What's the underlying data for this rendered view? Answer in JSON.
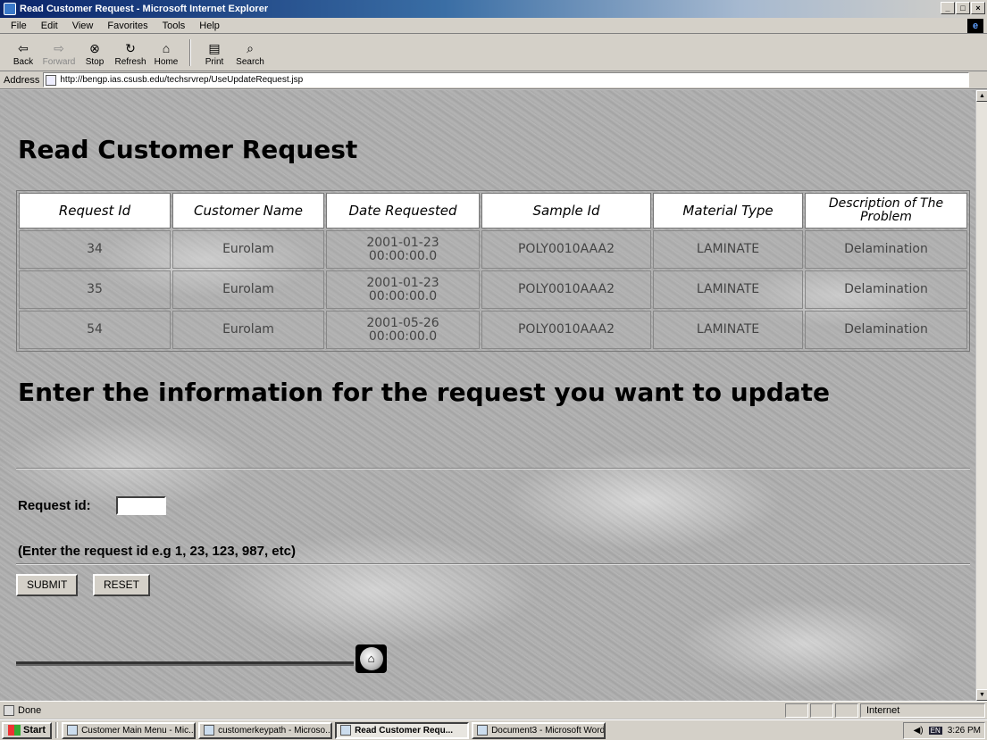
{
  "window": {
    "title": "Read Customer Request - Microsoft Internet Explorer"
  },
  "menu": [
    "File",
    "Edit",
    "View",
    "Favorites",
    "Tools",
    "Help"
  ],
  "toolbar": {
    "back": "Back",
    "forward": "Forward",
    "stop": "Stop",
    "refresh": "Refresh",
    "home": "Home",
    "print": "Print",
    "search": "Search"
  },
  "address": {
    "label": "Address",
    "url": "http://bengp.ias.csusb.edu/techsrvrep/UseUpdateRequest.jsp"
  },
  "page": {
    "title": "Read Customer Request",
    "table": {
      "headers": [
        "Request Id",
        "Customer Name",
        "Date Requested",
        "Sample Id",
        "Material Type",
        "Description of The Problem"
      ],
      "rows": [
        {
          "id": "34",
          "customer": "Eurolam",
          "date": "2001-01-23",
          "time": "00:00:00.0",
          "sample": "POLY0010AAA2",
          "material": "LAMINATE",
          "description": "Delamination"
        },
        {
          "id": "35",
          "customer": "Eurolam",
          "date": "2001-01-23",
          "time": "00:00:00.0",
          "sample": "POLY0010AAA2",
          "material": "LAMINATE",
          "description": "Delamination"
        },
        {
          "id": "54",
          "customer": "Eurolam",
          "date": "2001-05-26",
          "time": "00:00:00.0",
          "sample": "POLY0010AAA2",
          "material": "LAMINATE",
          "description": "Delamination"
        }
      ]
    },
    "instruction": "Enter the information for the request you want to update",
    "form": {
      "request_label": "Request id:",
      "request_value": "",
      "hint": "(Enter the request id e.g 1, 23, 123, 987, etc)",
      "submit": "SUBMIT",
      "reset": "RESET"
    }
  },
  "status": {
    "text": "Done",
    "zone": "Internet"
  },
  "taskbar": {
    "start": "Start",
    "tasks": [
      "Customer Main Menu - Mic...",
      "customerkeypath - Microso...",
      "Read Customer Requ...",
      "Document3 - Microsoft Word"
    ],
    "clock": "3:26 PM"
  }
}
